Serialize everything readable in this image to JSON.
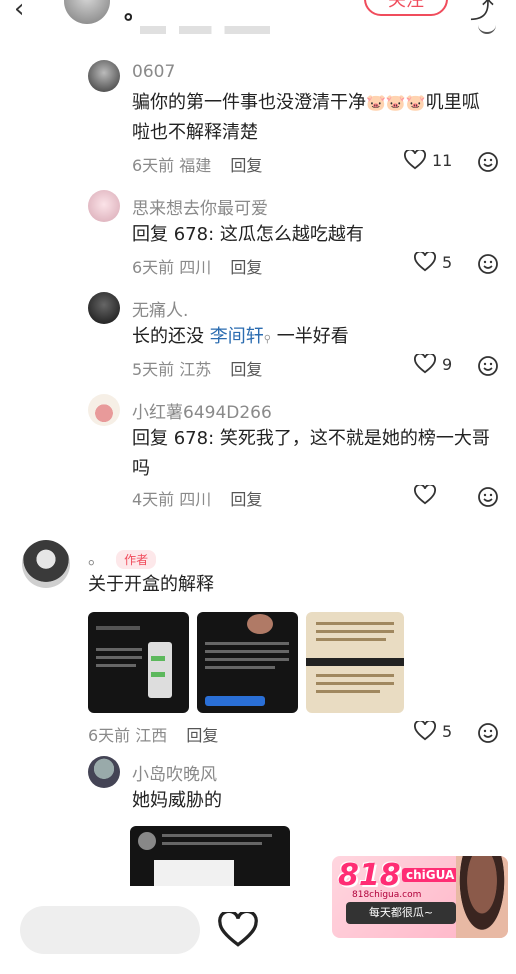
{
  "header": {
    "author_name": "。",
    "follow_label": "关注"
  },
  "comments": [
    {
      "user": "0607",
      "text_before_emoji": "骗你的第一件事也没澄清干净",
      "emoji": "🐷🐷🐷",
      "text_after_emoji": "叽里呱",
      "text_line2": "啦也不解释清楚",
      "time": "6天前",
      "location": "福建",
      "reply_label": "回复",
      "likes": "11"
    },
    {
      "user": "思来想去你最可爱",
      "text": "回复 678: 这瓜怎么越吃越有",
      "time": "6天前",
      "location": "四川",
      "reply_label": "回复",
      "likes": "5"
    },
    {
      "user": "无痛人.",
      "text_prefix": "长的还没",
      "text_link": "李间轩",
      "text_suffix": "一半好看",
      "time": "5天前",
      "location": "江苏",
      "reply_label": "回复",
      "likes": "9"
    },
    {
      "user": "小红薯6494D266",
      "text": "回复 678: 笑死我了，这不就是她的榜一大哥",
      "text_line2": "吗",
      "time": "4天前",
      "location": "四川",
      "reply_label": "回复",
      "likes": ""
    }
  ],
  "author_comment": {
    "user": "。",
    "tag": "作者",
    "text": "关于开盒的解释",
    "time": "6天前",
    "location": "江西",
    "reply_label": "回复",
    "likes": "5"
  },
  "reply_after": {
    "user": "小岛吹晚风",
    "text": "她妈威胁的"
  },
  "promo": {
    "brand": "818",
    "brand_sub": "chiGUA",
    "url": "818chigua.com",
    "slogan": "每天都很瓜~"
  },
  "colors": {
    "accent": "#f04c5c",
    "link": "#2b6cb0",
    "meta_gray": "#8a8a8a"
  },
  "icons": {
    "back": "chevron-left-icon",
    "share": "share-icon",
    "like": "heart-icon",
    "emoji": "smile-icon"
  }
}
